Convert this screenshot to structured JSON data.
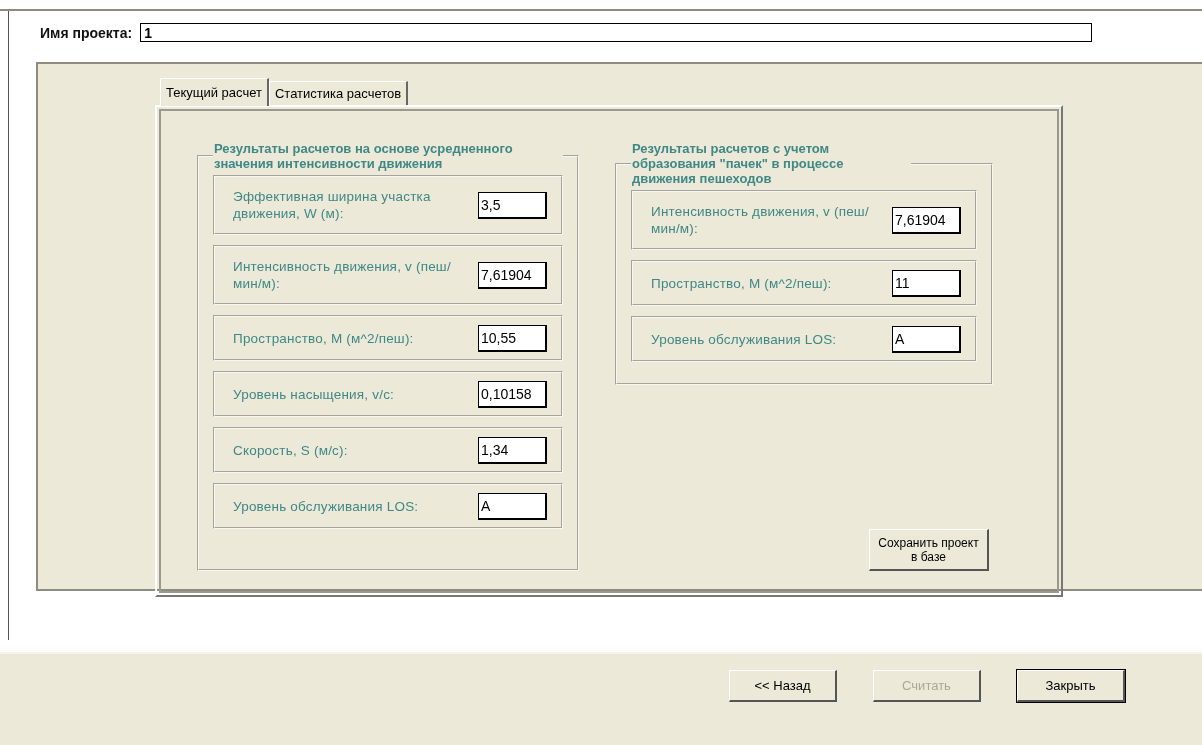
{
  "project": {
    "label": "Имя проекта:",
    "value": "1"
  },
  "tabs": [
    {
      "label": "Текущий расчет",
      "selected": true
    },
    {
      "label": "Статистика расчетов",
      "selected": false
    }
  ],
  "groups": [
    {
      "title": "Результаты расчетов на основе усредненного значения интенсивности движения",
      "rows": [
        {
          "label": "Эффективная ширина участка движения, W  (м):",
          "value": "3,5"
        },
        {
          "label": "Интенсивность движения, v (пеш/мин/м):",
          "value": "7,61904"
        },
        {
          "label": "Пространство, M (м^2/пеш):",
          "value": "10,55"
        },
        {
          "label": "Уровень насыщения, v/c:",
          "value": "0,10158"
        },
        {
          "label": "Скорость, S (м/с):",
          "value": "1,34"
        },
        {
          "label": "Уровень обслуживания LOS:",
          "value": "A"
        }
      ]
    },
    {
      "title": "Результаты расчетов с учетом образования \"пачек\" в процессе движения пешеходов",
      "rows": [
        {
          "label": "Интенсивность движения, v (пеш/мин/м):",
          "value": "7,61904"
        },
        {
          "label": "Пространство, M (м^2/пеш):",
          "value": "11"
        },
        {
          "label": "Уровень обслуживания LOS:",
          "value": "A"
        }
      ]
    }
  ],
  "save_button": "Сохранить проект в базе",
  "buttons": [
    {
      "label": "<< Назад",
      "disabled": false,
      "default": false
    },
    {
      "label": "Считать",
      "disabled": true,
      "default": false
    },
    {
      "label": "Закрыть",
      "disabled": false,
      "default": true
    }
  ]
}
